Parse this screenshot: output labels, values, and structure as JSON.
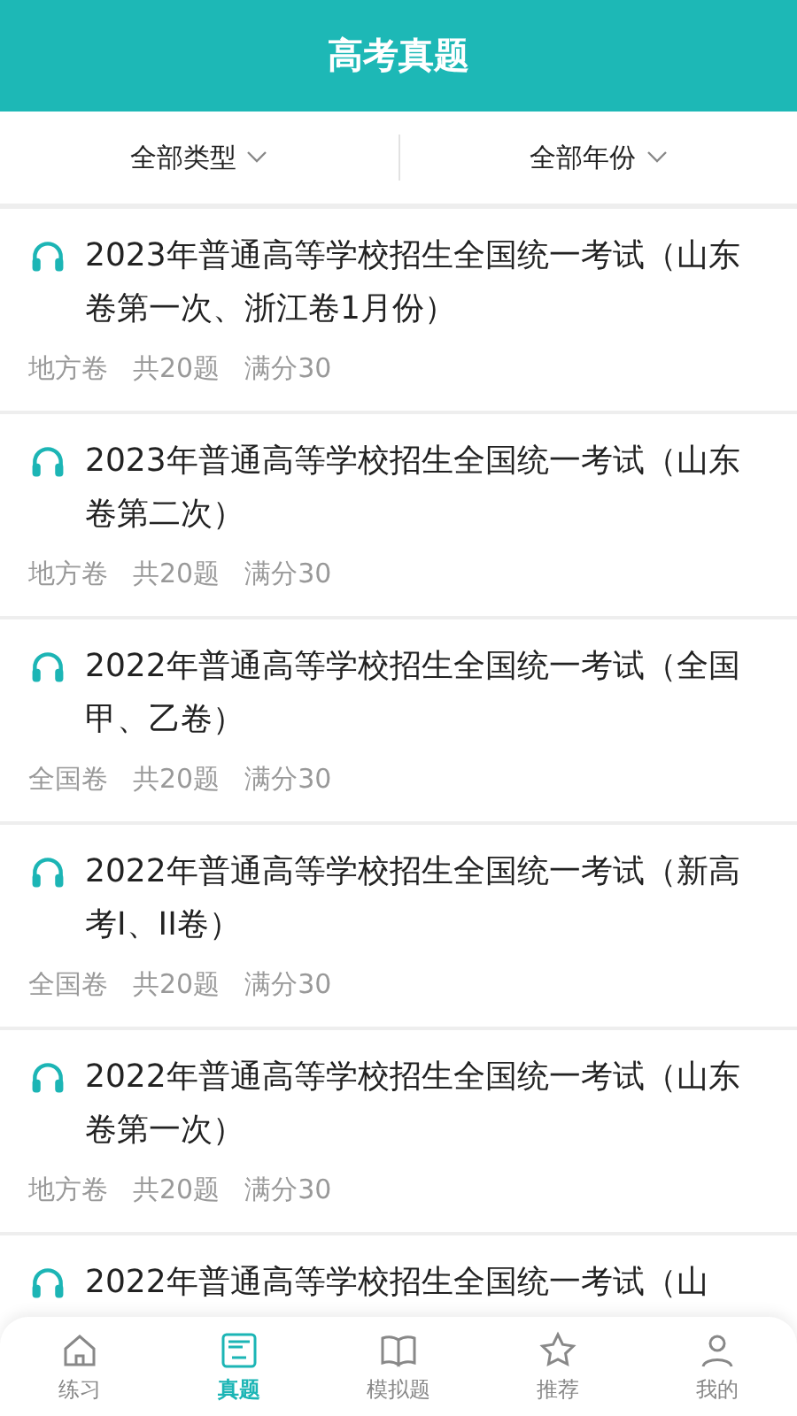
{
  "header": {
    "title": "高考真题"
  },
  "filters": [
    {
      "label": "全部类型"
    },
    {
      "label": "全部年份"
    }
  ],
  "papers": [
    {
      "title": "2023年普通高等学校招生全国统一考试（山东卷第一次、浙江卷1月份）",
      "type": "地方卷",
      "count": "共20题",
      "score": "满分30"
    },
    {
      "title": "2023年普通高等学校招生全国统一考试（山东卷第二次）",
      "type": "地方卷",
      "count": "共20题",
      "score": "满分30"
    },
    {
      "title": "2022年普通高等学校招生全国统一考试（全国甲、乙卷）",
      "type": "全国卷",
      "count": "共20题",
      "score": "满分30"
    },
    {
      "title": "2022年普通高等学校招生全国统一考试（新高考I、II卷）",
      "type": "全国卷",
      "count": "共20题",
      "score": "满分30"
    },
    {
      "title": "2022年普通高等学校招生全国统一考试（山东卷第一次）",
      "type": "地方卷",
      "count": "共20题",
      "score": "满分30"
    },
    {
      "title": "2022年普通高等学校招生全国统一考试（山"
    }
  ],
  "tab_bar": [
    {
      "label": "练习",
      "kind": "home",
      "selected": false
    },
    {
      "label": "真题",
      "kind": "paper",
      "selected": true
    },
    {
      "label": "模拟题",
      "kind": "book",
      "selected": false
    },
    {
      "label": "推荐",
      "kind": "star",
      "selected": false
    },
    {
      "label": "我的",
      "kind": "person",
      "selected": false
    }
  ]
}
